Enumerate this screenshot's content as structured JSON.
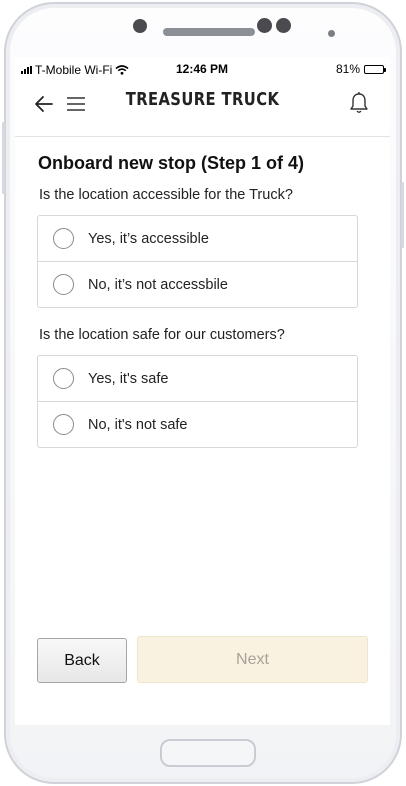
{
  "status_bar": {
    "carrier": "T-Mobile Wi-Fi",
    "time": "12:46 PM",
    "battery": "81%",
    "battery_level": 0.81,
    "wifi_icon": "wifi-icon",
    "signal_icon": "cellular-signal-icon"
  },
  "nav": {
    "back_icon": "back-arrow-icon",
    "menu_icon": "hamburger-menu-icon",
    "logo": "TREASURE TRUCK",
    "notifications_icon": "bell-icon"
  },
  "page": {
    "title": "Onboard new stop (Step 1 of 4)"
  },
  "questions": [
    {
      "text": "Is the location accessible for the Truck?",
      "options": [
        "Yes, it’s accessible",
        "No, it’s not accessbile"
      ]
    },
    {
      "text": "Is the location safe for our customers?",
      "options": [
        "Yes, it's safe",
        "No, it's not safe"
      ]
    }
  ],
  "actions": {
    "back_label": "Back",
    "next_label": "Next",
    "next_disabled": true
  },
  "colors": {
    "next_bg": "#f9f2e0",
    "next_text": "#a8a29a",
    "border": "#d7d7d7"
  }
}
